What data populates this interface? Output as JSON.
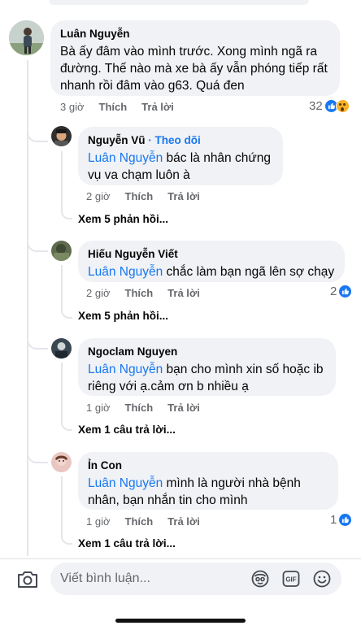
{
  "comments": {
    "main": {
      "author": "Luân Nguyễn",
      "text": "Bà ấy đâm vào mình trước. Xong mình ngã ra đường. Thế nào mà xe bà ấy vẫn phóng tiếp rất nhanh rồi đâm vào g63. Quá đen",
      "time": "3 giờ",
      "like": "Thích",
      "reply": "Trả lời",
      "reactions": "32",
      "reaction_icons": [
        "like-icon",
        "wow-icon"
      ]
    },
    "replies": [
      {
        "author": "Nguyễn Vũ",
        "separator": " · ",
        "follow": "Theo dõi",
        "mention": "Luân Nguyễn",
        "text": " bác là nhân chứng vụ va chạm luôn à",
        "time": "2 giờ",
        "like": "Thích",
        "reply": "Trả lời",
        "more": "Xem 5 phản hồi..."
      },
      {
        "author": "Hiếu Nguyễn Viết",
        "mention": "Luân Nguyễn",
        "text": " chắc làm bạn ngã lên sợ chạy",
        "time": "2 giờ",
        "like": "Thích",
        "reply": "Trả lời",
        "reactions": "2",
        "more": "Xem 5 phản hồi..."
      },
      {
        "author": "Ngoclam Nguyen",
        "mention": "Luân Nguyễn",
        "text": " bạn cho mình xin số hoặc ib riêng với ạ.cảm ơn b nhiều ạ",
        "time": "1 giờ",
        "like": "Thích",
        "reply": "Trả lời",
        "more": "Xem 1 câu trả lời..."
      },
      {
        "author": "Ỉn Con",
        "mention": "Luân Nguyễn",
        "text": " mình là người nhà bệnh nhân, bạn nhắn tin cho mình",
        "time": "1 giờ",
        "like": "Thích",
        "reply": "Trả lời",
        "reactions": "1",
        "more": "Xem 1 câu trả lời..."
      }
    ]
  },
  "composer": {
    "placeholder": "Viết bình luận...",
    "icons": [
      "camera-icon",
      "avatar-sticker-icon",
      "gif-icon",
      "emoji-icon"
    ]
  },
  "colors": {
    "accent": "#1877f2",
    "bubble": "#f0f2f5",
    "meta": "#65676b"
  }
}
